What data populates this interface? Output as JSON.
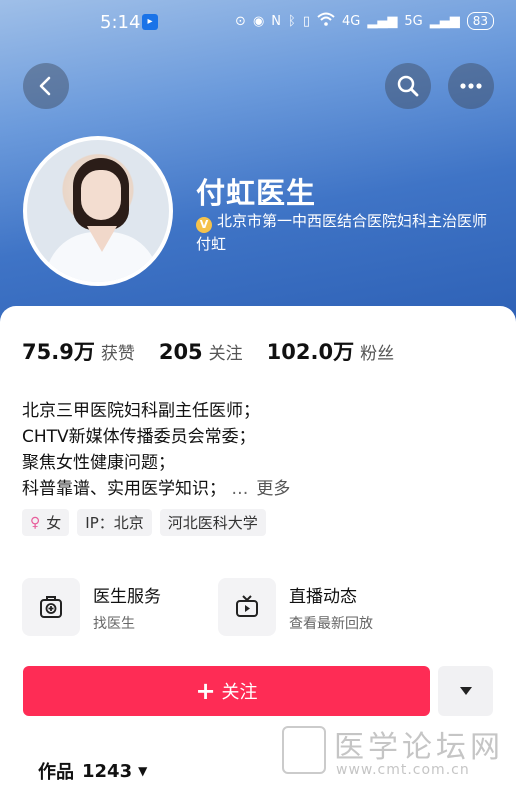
{
  "status_bar": {
    "time": "5:14",
    "signal_4g": "4G",
    "signal_5g": "5G",
    "battery": "83"
  },
  "header": {
    "back_icon": "chevron-left-icon",
    "search_icon": "search-icon",
    "more_icon": "more-horizontal-icon"
  },
  "profile": {
    "name": "付虹医生",
    "verify_badge": "V",
    "verification": "北京市第一中西医结合医院妇科主治医师 付虹"
  },
  "stats": [
    {
      "value": "75.9万",
      "label": "获赞"
    },
    {
      "value": "205",
      "label": "关注"
    },
    {
      "value": "102.0万",
      "label": "粉丝"
    }
  ],
  "bio": {
    "lines": [
      "北京三甲医院妇科副主任医师；",
      "CHTV新媒体传播委员会常委；",
      "聚焦女性健康问题；",
      "科普靠谱、实用医学知识；"
    ],
    "ellipsis": "…",
    "more_label": "更多"
  },
  "tags": {
    "gender": "女",
    "ip": "IP：北京",
    "school": "河北医科大学"
  },
  "services": [
    {
      "title": "医生服务",
      "subtitle": "找医生",
      "icon": "medical-kit-icon"
    },
    {
      "title": "直播动态",
      "subtitle": "查看最新回放",
      "icon": "tv-icon"
    }
  ],
  "actions": {
    "follow_label": "关注",
    "follow_plus": "+"
  },
  "works": {
    "label": "作品",
    "count": "1243"
  },
  "watermark": {
    "text": "医学论坛网",
    "url": "www.cmt.com.cn"
  },
  "colors": {
    "accent": "#fe2c55",
    "header_blue": "#3f74c6",
    "verify_gold": "#f5c24b",
    "gender_pink": "#e85d9b"
  }
}
